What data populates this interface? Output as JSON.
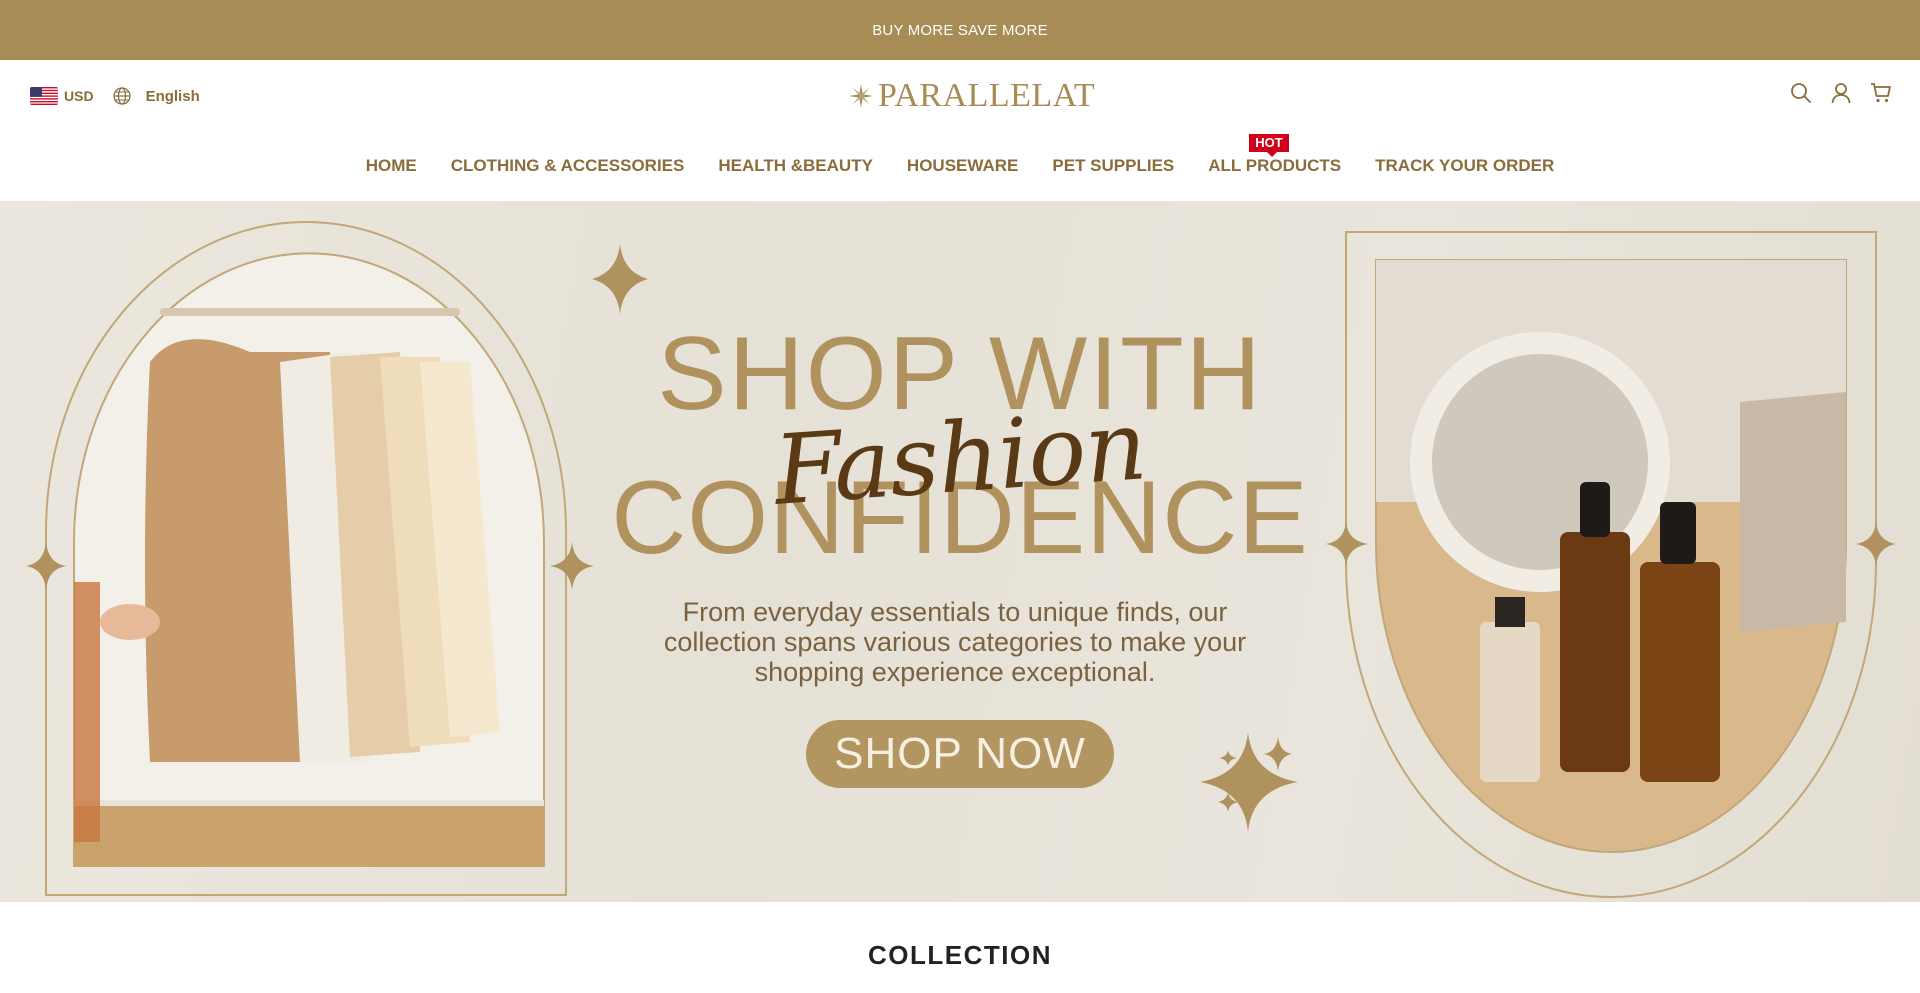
{
  "announcement": {
    "text": "⁣BUY MORE SAVE MORE⁣"
  },
  "header": {
    "currency": "USD",
    "language": "English",
    "logo_text": "PARALLELAT",
    "icons": {
      "search": "search-icon",
      "account": "user-icon",
      "cart": "cart-icon"
    }
  },
  "nav": {
    "items": [
      {
        "label": "HOME"
      },
      {
        "label": "CLOTHING & ACCESSORIES"
      },
      {
        "label": "HEALTH &BEAUTY"
      },
      {
        "label": "HOUSEWARE"
      },
      {
        "label": "PET SUPPLIES"
      },
      {
        "label": "ALL PRODUCTS",
        "badge": "HOT"
      },
      {
        "label": "TRACK YOUR ORDER"
      }
    ]
  },
  "hero": {
    "headline_line1": "SHOP WITH",
    "script_word": "Fashion",
    "headline_line2": "CONFIDENCE",
    "subtext": "From everyday essentials to unique finds, our collection spans various categories to make your shopping experience exceptional.",
    "button_label": "SHOP NOW"
  },
  "collection": {
    "title": "COLLECTION"
  },
  "colors": {
    "brand": "#a88c55",
    "text_gold": "#8a6d3b",
    "hot_badge": "#d0021b"
  }
}
